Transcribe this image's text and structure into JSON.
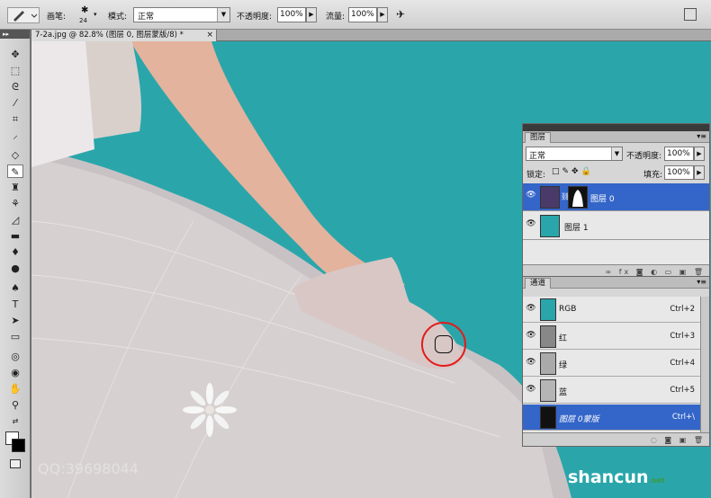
{
  "options_bar": {
    "brush_label": "画笔:",
    "brush_size": "24",
    "mode_label": "模式:",
    "mode_value": "正常",
    "opacity_label": "不透明度:",
    "opacity_value": "100%",
    "flow_label": "流量:",
    "flow_value": "100%"
  },
  "document": {
    "tab_title": "7-2a.jpg @ 82.8% (图层 0, 图层蒙版/8) *",
    "close_glyph": "×"
  },
  "layers_panel": {
    "tab": "图层",
    "blend_mode": "正常",
    "opacity_label": "不透明度:",
    "opacity_value": "100%",
    "lock_label": "锁定:",
    "fill_label": "填充:",
    "fill_value": "100%",
    "layers": [
      {
        "name": "图层 0",
        "selected": true
      },
      {
        "name": "图层 1",
        "selected": false
      }
    ]
  },
  "channels_panel": {
    "tab": "通道",
    "channels": [
      {
        "name": "RGB",
        "shortcut": "Ctrl+2"
      },
      {
        "name": "红",
        "shortcut": "Ctrl+3"
      },
      {
        "name": "绿",
        "shortcut": "Ctrl+4"
      },
      {
        "name": "蓝",
        "shortcut": "Ctrl+5"
      },
      {
        "name": "图层 0蒙版",
        "shortcut": "Ctrl+\\"
      }
    ]
  },
  "watermarks": {
    "left": "QQ:39698044",
    "right_main": "shancun",
    "right_net": ".net"
  },
  "colors": {
    "canvas_bg": "#2aa6ab",
    "selection": "#3465c8",
    "cursor_ring": "#e31b1b"
  }
}
